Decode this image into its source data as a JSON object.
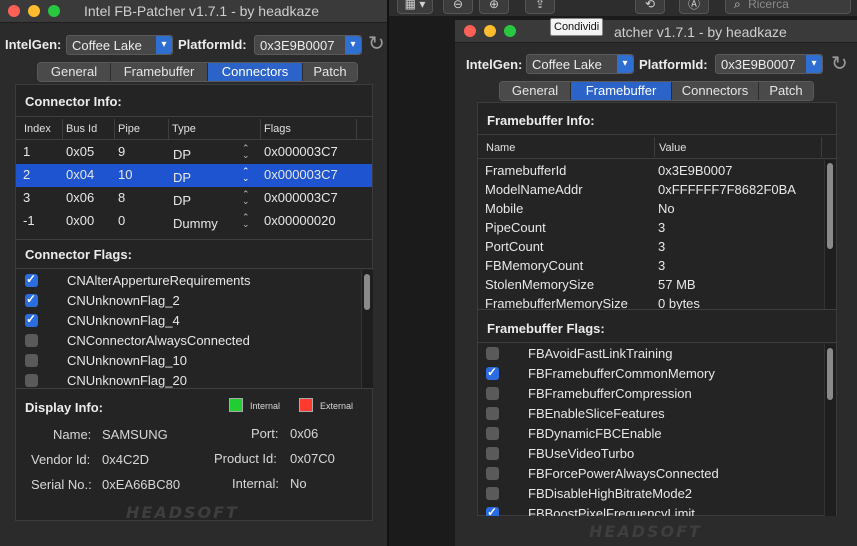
{
  "left": {
    "title": "Intel FB-Patcher v1.7.1 - by headkaze",
    "intelgen_label": "IntelGen:",
    "intelgen_value": "Coffee Lake",
    "platform_label": "PlatformId:",
    "platform_value": "0x3E9B0007",
    "tabs": [
      "General",
      "Framebuffer",
      "Connectors",
      "Patch"
    ],
    "connector_info_title": "Connector Info:",
    "columns": [
      "Index",
      "Bus Id",
      "Pipe",
      "Type",
      "Flags"
    ],
    "rows": [
      {
        "index": "1",
        "bus": "0x05",
        "pipe": "9",
        "type": "DP",
        "flags": "0x000003C7"
      },
      {
        "index": "2",
        "bus": "0x04",
        "pipe": "10",
        "type": "DP",
        "flags": "0x000003C7"
      },
      {
        "index": "3",
        "bus": "0x06",
        "pipe": "8",
        "type": "DP",
        "flags": "0x000003C7"
      },
      {
        "index": "-1",
        "bus": "0x00",
        "pipe": "0",
        "type": "Dummy",
        "flags": "0x00000020"
      }
    ],
    "connector_flags_title": "Connector Flags:",
    "flags": [
      {
        "label": "CNAlterAppertureRequirements",
        "checked": true
      },
      {
        "label": "CNUnknownFlag_2",
        "checked": true
      },
      {
        "label": "CNUnknownFlag_4",
        "checked": true
      },
      {
        "label": "CNConnectorAlwaysConnected",
        "checked": false
      },
      {
        "label": "CNUnknownFlag_10",
        "checked": false
      },
      {
        "label": "CNUnknownFlag_20",
        "checked": false
      }
    ],
    "display_info_title": "Display Info:",
    "legend_internal": "Internal",
    "legend_external": "External",
    "internal_color": "#22cc33",
    "external_color": "#ff3b30",
    "display": {
      "name_label": "Name:",
      "name_value": "SAMSUNG",
      "port_label": "Port:",
      "port_value": "0x06",
      "vendor_label": "Vendor Id:",
      "vendor_value": "0x4C2D",
      "product_label": "Product Id:",
      "product_value": "0x07C0",
      "serial_label": "Serial No.:",
      "serial_value": "0xEA66BC80",
      "internal_label": "Internal:",
      "internal_value": "No"
    },
    "logo": "HEADSOFT"
  },
  "right": {
    "title": "atcher v1.7.1 - by headkaze",
    "tooltip": "Condividi",
    "search_placeholder": "Ricerca",
    "intelgen_label": "IntelGen:",
    "intelgen_value": "Coffee Lake",
    "platform_label": "PlatformId:",
    "platform_value": "0x3E9B0007",
    "tabs": [
      "General",
      "Framebuffer",
      "Connectors",
      "Patch"
    ],
    "fb_info_title": "Framebuffer Info:",
    "columns": [
      "Name",
      "Value"
    ],
    "rows": [
      {
        "name": "FramebufferId",
        "value": "0x3E9B0007"
      },
      {
        "name": "ModelNameAddr",
        "value": "0xFFFFFF7F8682F0BA"
      },
      {
        "name": "Mobile",
        "value": "No"
      },
      {
        "name": "PipeCount",
        "value": "3"
      },
      {
        "name": "PortCount",
        "value": "3"
      },
      {
        "name": "FBMemoryCount",
        "value": "3"
      },
      {
        "name": "StolenMemorySize",
        "value": "57 MB"
      },
      {
        "name": "FramebufferMemorySize",
        "value": "0 bytes"
      }
    ],
    "fb_flags_title": "Framebuffer Flags:",
    "flags": [
      {
        "label": "FBAvoidFastLinkTraining",
        "checked": false
      },
      {
        "label": "FBFramebufferCommonMemory",
        "checked": true
      },
      {
        "label": "FBFramebufferCompression",
        "checked": false
      },
      {
        "label": "FBEnableSliceFeatures",
        "checked": false
      },
      {
        "label": "FBDynamicFBCEnable",
        "checked": false
      },
      {
        "label": "FBUseVideoTurbo",
        "checked": false
      },
      {
        "label": "FBForcePowerAlwaysConnected",
        "checked": false
      },
      {
        "label": "FBDisableHighBitrateMode2",
        "checked": false
      },
      {
        "label": "FBBoostPixelFrequencyLimit",
        "checked": true
      }
    ],
    "logo": "HEADSOFT"
  }
}
